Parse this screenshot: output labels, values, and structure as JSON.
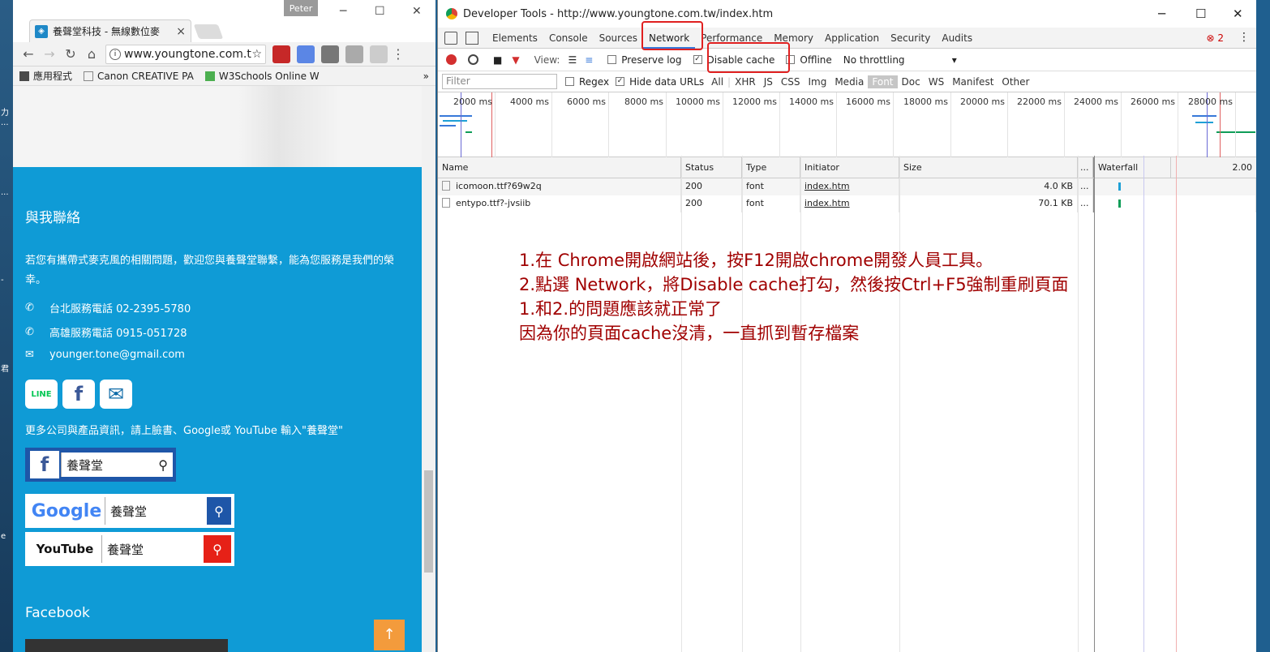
{
  "desktop": {
    "side_chars": [
      "力",
      "...",
      "...",
      "-",
      "君",
      "e"
    ]
  },
  "browser": {
    "tab_title": "養聲堂科技 - 無線數位麥",
    "tab_close": "×",
    "user": "Peter",
    "url": "www.youngtone.com.t",
    "bookmarks": [
      {
        "label": "應用程式",
        "color": "#4a4a4a"
      },
      {
        "label": "Canon CREATIVE PA",
        "color": "#888888"
      },
      {
        "label": "W3Schools Online W",
        "color": "#4caf50"
      }
    ],
    "bookmarks_more": "»"
  },
  "page": {
    "contact_title": "與我聯絡",
    "intro": "若您有攜帶式麥克風的相關問題，歡迎您與養聲堂聯繫，能為您服務是我們的榮幸。",
    "phone_taipei": "台北服務電話 02-2395-5780",
    "phone_kaohsiung": "高雄服務電話 0915-051728",
    "email": "younger.tone@gmail.com",
    "social": [
      "LINE",
      "f",
      "✉"
    ],
    "more_info": "更多公司與產品資訊，請上臉書、Google或 YouTube 輸入\"養聲堂\"",
    "search_keyword": "養聲堂",
    "brand_google": "Google",
    "brand_youtube": "YouTube",
    "facebook_title": "Facebook",
    "to_top": "↑"
  },
  "devtools": {
    "window_title": "Developer Tools - http://www.youngtone.com.tw/index.htm",
    "tabs": [
      "Elements",
      "Console",
      "Sources",
      "Network",
      "Performance",
      "Memory",
      "Application",
      "Security",
      "Audits"
    ],
    "active_tab": "Network",
    "error_count": "2",
    "controls": {
      "view_label": "View:",
      "preserve_log": "Preserve log",
      "disable_cache": "Disable cache",
      "offline": "Offline",
      "throttling": "No throttling"
    },
    "filter": {
      "placeholder": "Filter",
      "regex": "Regex",
      "hide_data_urls": "Hide data URLs",
      "types": [
        "All",
        "XHR",
        "JS",
        "CSS",
        "Img",
        "Media",
        "Font",
        "Doc",
        "WS",
        "Manifest",
        "Other"
      ],
      "active_type": "Font"
    },
    "timeline_ticks": [
      "2000 ms",
      "4000 ms",
      "6000 ms",
      "8000 ms",
      "10000 ms",
      "12000 ms",
      "14000 ms",
      "16000 ms",
      "18000 ms",
      "20000 ms",
      "22000 ms",
      "24000 ms",
      "26000 ms",
      "28000 ms"
    ],
    "columns": [
      "Name",
      "Status",
      "Type",
      "Initiator",
      "Size",
      "...",
      "Waterfall"
    ],
    "waterfall_scale": "2.00",
    "rows": [
      {
        "name": "icomoon.ttf?69w2q",
        "status": "200",
        "type": "font",
        "initiator": "index.htm",
        "size": "4.0 KB",
        "more": "..."
      },
      {
        "name": "entypo.ttf?-jvsiib",
        "status": "200",
        "type": "font",
        "initiator": "index.htm",
        "size": "70.1 KB",
        "more": "..."
      }
    ],
    "annotation": [
      "1.在 Chrome開啟網站後，按F12開啟chrome開發人員工具。",
      "2.點選 Network，將Disable cache打勾，然後按Ctrl+F5強制重刷頁面",
      "1.和2.的問題應該就正常了",
      "因為你的頁面cache沒清，一直抓到暫存檔案"
    ],
    "annotation_color": "#a00000",
    "highlight_color": "#e02020"
  }
}
